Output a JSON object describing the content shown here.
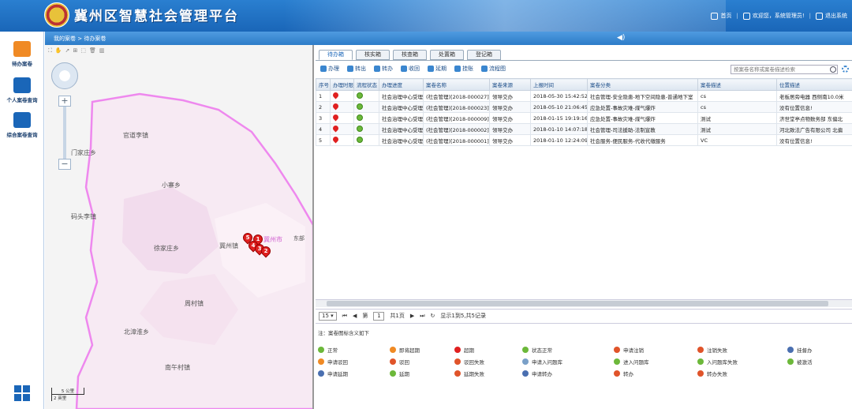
{
  "header": {
    "title": "冀州区智慧社会管理平台",
    "nav": [
      "首页",
      "欢迎您，系统管理员!",
      "退出系统"
    ]
  },
  "sidebar": {
    "items": [
      {
        "label": "待办案卷",
        "color": "#f08a24"
      },
      {
        "label": "个人案卷查询",
        "color": "#1a66b8"
      },
      {
        "label": "综合案卷查询",
        "color": "#1a66b8"
      }
    ]
  },
  "breadcrumb": "我的案卷 > 待办案卷",
  "map": {
    "places": [
      "官道李镇",
      "门家庄乡",
      "小寨乡",
      "码头李镇",
      "徐家庄乡",
      "冀州镇",
      "冀州市",
      "周村镇",
      "北漳淮乡",
      "南午村镇",
      "东部"
    ],
    "pins": [
      "5",
      "1",
      "4",
      "3",
      "2"
    ],
    "scale": [
      "5 公里",
      "2 英里"
    ]
  },
  "tabs": [
    "待办箱",
    "核实箱",
    "核查箱",
    "处置箱",
    "登记箱"
  ],
  "toolbar": [
    "办理",
    "转出",
    "转办",
    "收回",
    "延期",
    "挂账",
    "流程图"
  ],
  "search_placeholder": "按案卷名称或案卷描述检索",
  "table": {
    "columns": [
      "序号",
      "办理时限",
      "流程状态",
      "办理进度",
      "案卷名称",
      "案卷来源",
      "上报时间",
      "案卷分类",
      "案卷描述",
      "位置描述"
    ],
    "rows": [
      [
        "1",
        "社会治理中心受理",
        "(社会管理)[2018-000027]",
        "领导交办",
        "2018-05-30 15:42:52",
        "社会管理-安全隐患-地下空间隐患-普通地下室",
        "cs",
        "老板居旁电器 西侧南10.0米"
      ],
      [
        "2",
        "社会治理中心受理",
        "(社会管理)[2018-000023]",
        "领导交办",
        "2018-05-10 21:06:45",
        "应急处置-事故灾难-煤气爆炸",
        "cs",
        "没有位置信息!"
      ],
      [
        "3",
        "社会治理中心受理",
        "(社会管理)[2018-000009]",
        "领导交办",
        "2018-01-15 19:19:16",
        "应急处置-事故灾难-煤气爆炸",
        "测试",
        "济世堂亭点物数务部 东偏北"
      ],
      [
        "4",
        "社会治理中心受理",
        "(社会管理)[2018-000002]",
        "领导交办",
        "2018-01-10 14:07:18",
        "社会管理-司法援助-法制宣教",
        "测试",
        "河北致法广告有限公司 北偏"
      ],
      [
        "5",
        "社会治理中心受理",
        "(社会管理)[2018-000001]",
        "领导交办",
        "2018-01-10 12:24:09",
        "社会服务-便民服务-代收代缴服务",
        "VC",
        "没有位置信息!"
      ]
    ]
  },
  "pager": {
    "page_size": "15",
    "page_label": "第",
    "page": "1",
    "total_pages": "共1页",
    "summary": "显示1到5,共5记录"
  },
  "legend": {
    "title": "注：案卷图标含义如下",
    "items": [
      {
        "label": "正常",
        "color": "#6cb83a"
      },
      {
        "label": "即将超期",
        "color": "#f08a24"
      },
      {
        "label": "超期",
        "color": "#e02020"
      },
      {
        "label": "状态正常",
        "color": "#6cb83a"
      },
      {
        "label": "申请注销",
        "color": "#e0542a"
      },
      {
        "label": "注销失败",
        "color": "#e0542a"
      },
      {
        "label": "挂督办",
        "color": "#4a6fb0"
      },
      {
        "label": "申请驳回",
        "color": "#f08a24"
      },
      {
        "label": "驳回",
        "color": "#e0542a"
      },
      {
        "label": "驳回失败",
        "color": "#e0542a"
      },
      {
        "label": "申请入问题库",
        "color": "#7aa0c8"
      },
      {
        "label": "进入问题库",
        "color": "#6cb83a"
      },
      {
        "label": "入问题库失败",
        "color": "#6cb83a"
      },
      {
        "label": "被激活",
        "color": "#6cb83a"
      },
      {
        "label": "申请延期",
        "color": "#4a6fb0"
      },
      {
        "label": "延期",
        "color": "#6cb83a"
      },
      {
        "label": "延期失败",
        "color": "#e0542a"
      },
      {
        "label": "申请转办",
        "color": "#4a6fb0"
      },
      {
        "label": "转办",
        "color": "#e0542a"
      },
      {
        "label": "转办失败",
        "color": "#e0542a"
      }
    ]
  }
}
